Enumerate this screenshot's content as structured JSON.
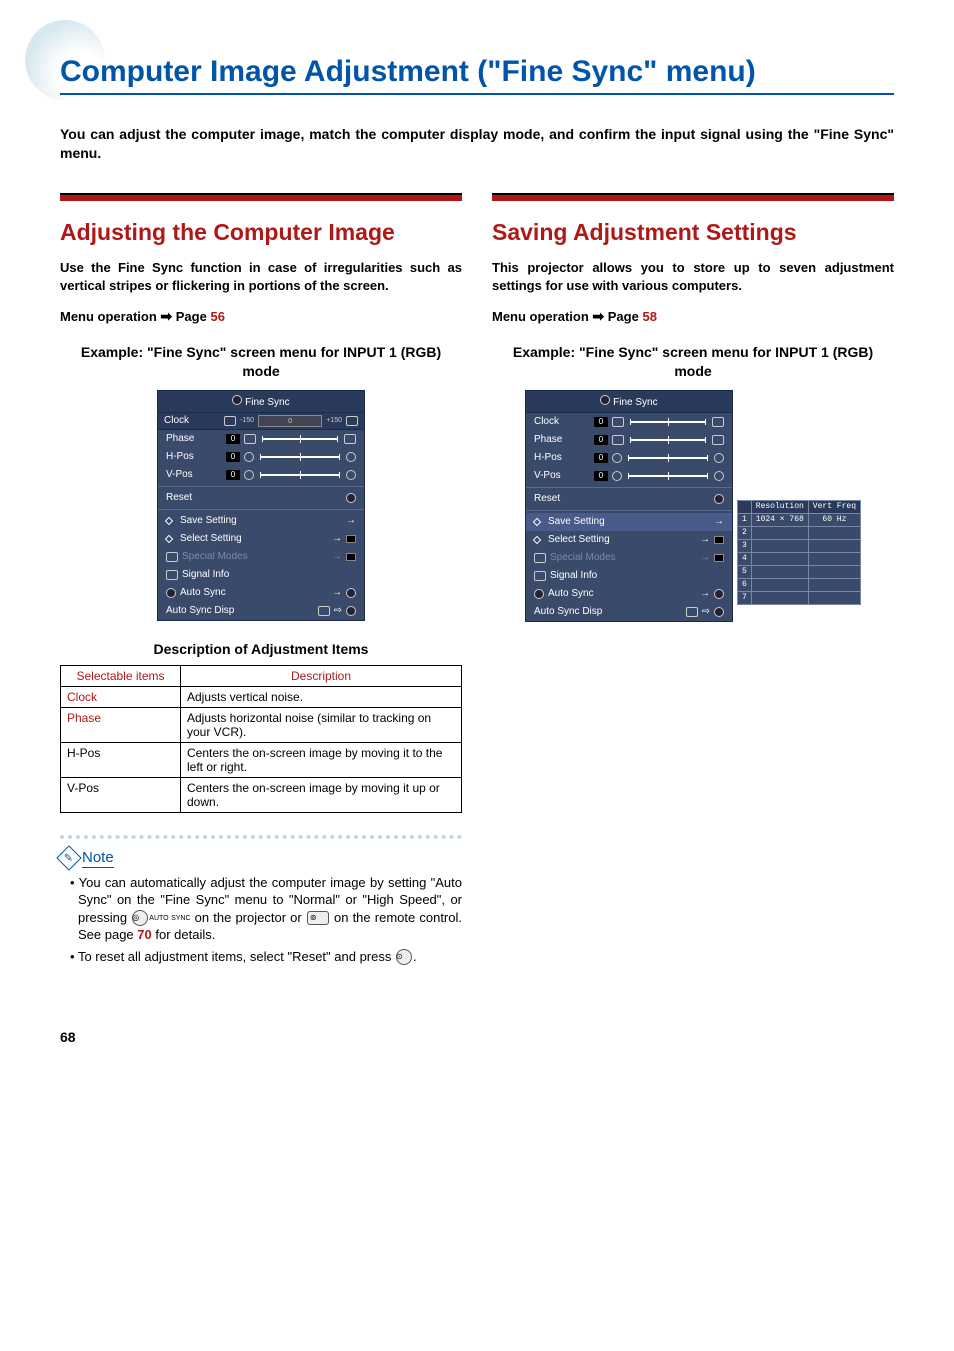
{
  "title": "Computer Image Adjustment (\"Fine Sync\" menu)",
  "intro": "You can adjust the computer image, match the computer display mode, and confirm the input signal using the \"Fine Sync\" menu.",
  "left": {
    "heading": "Adjusting the Computer Image",
    "body": "Use the Fine Sync function in case of irregularities such as vertical stripes or flickering in portions of the screen.",
    "menu_op_prefix": "Menu operation",
    "menu_op_page_label": "Page",
    "menu_op_page": "56",
    "example": "Example: \"Fine Sync\" screen menu for INPUT 1 (RGB) mode",
    "osd": {
      "title": "Fine Sync",
      "clock_label": "Clock",
      "clock_min": "-150",
      "clock_val": "0",
      "clock_max": "+150",
      "rows": [
        {
          "label": "Phase",
          "val": "0"
        },
        {
          "label": "H-Pos",
          "val": "0"
        },
        {
          "label": "V-Pos",
          "val": "0"
        }
      ],
      "reset": "Reset",
      "save": "Save Setting",
      "select": "Select Setting",
      "special": "Special Modes",
      "signal": "Signal Info",
      "auto": "Auto Sync",
      "autodisp": "Auto Sync Disp"
    },
    "desc_heading": "Description of Adjustment Items",
    "table": {
      "h1": "Selectable items",
      "h2": "Description",
      "rows": [
        {
          "item": "Clock",
          "red": true,
          "desc": "Adjusts vertical noise."
        },
        {
          "item": "Phase",
          "red": true,
          "desc": "Adjusts horizontal noise (similar to tracking on your VCR)."
        },
        {
          "item": "H-Pos",
          "red": false,
          "desc": "Centers the on-screen image by moving it to the left or right."
        },
        {
          "item": "V-Pos",
          "red": false,
          "desc": "Centers the on-screen image by moving it up or down."
        }
      ]
    },
    "note_label": "Note",
    "notes": {
      "n1a": "You can automatically adjust the computer image by setting \"Auto Sync\" on the \"Fine Sync\" menu to \"Normal\" or \"High Speed\", or pressing ",
      "n1b": " on the projector or ",
      "n1c": " on the remote control. See page ",
      "n1page": "70",
      "n1d": " for details.",
      "n2a": "To reset all adjustment items, select \"Reset\" and press ",
      "n2b": "."
    }
  },
  "right": {
    "heading": "Saving Adjustment Settings",
    "body": "This projector allows you to store up to seven adjustment settings for use with various computers.",
    "menu_op_prefix": "Menu operation",
    "menu_op_page_label": "Page",
    "menu_op_page": "58",
    "example": "Example: \"Fine Sync\" screen menu for INPUT 1 (RGB) mode",
    "osd": {
      "title": "Fine Sync",
      "rows": [
        {
          "label": "Clock",
          "val": "0"
        },
        {
          "label": "Phase",
          "val": "0"
        },
        {
          "label": "H-Pos",
          "val": "0"
        },
        {
          "label": "V-Pos",
          "val": "0"
        }
      ],
      "reset": "Reset",
      "save": "Save Setting",
      "select": "Select Setting",
      "special": "Special Modes",
      "signal": "Signal Info",
      "auto": "Auto Sync",
      "autodisp": "Auto Sync Disp"
    },
    "settings_table": {
      "h1": "Resolution",
      "h2": "Vert Freq",
      "rows": [
        {
          "idx": "1",
          "res": "1024 × 768",
          "freq": "60 Hz"
        },
        {
          "idx": "2",
          "res": "",
          "freq": ""
        },
        {
          "idx": "3",
          "res": "",
          "freq": ""
        },
        {
          "idx": "4",
          "res": "",
          "freq": ""
        },
        {
          "idx": "5",
          "res": "",
          "freq": ""
        },
        {
          "idx": "6",
          "res": "",
          "freq": ""
        },
        {
          "idx": "7",
          "res": "",
          "freq": ""
        }
      ]
    }
  },
  "page_number": "68"
}
